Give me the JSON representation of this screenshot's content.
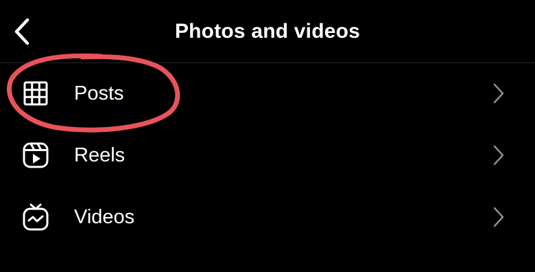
{
  "header": {
    "title": "Photos and videos",
    "back_icon": "chevron-left-icon"
  },
  "menu": {
    "items": [
      {
        "label": "Posts",
        "icon": "grid-icon",
        "chevron": "chevron-right-icon"
      },
      {
        "label": "Reels",
        "icon": "reels-icon",
        "chevron": "chevron-right-icon"
      },
      {
        "label": "Videos",
        "icon": "igtv-icon",
        "chevron": "chevron-right-icon"
      }
    ]
  },
  "colors": {
    "background": "#000000",
    "text": "#ffffff",
    "chevron": "#8e8e8e",
    "divider": "#262626",
    "annotation": "#e8535a"
  }
}
